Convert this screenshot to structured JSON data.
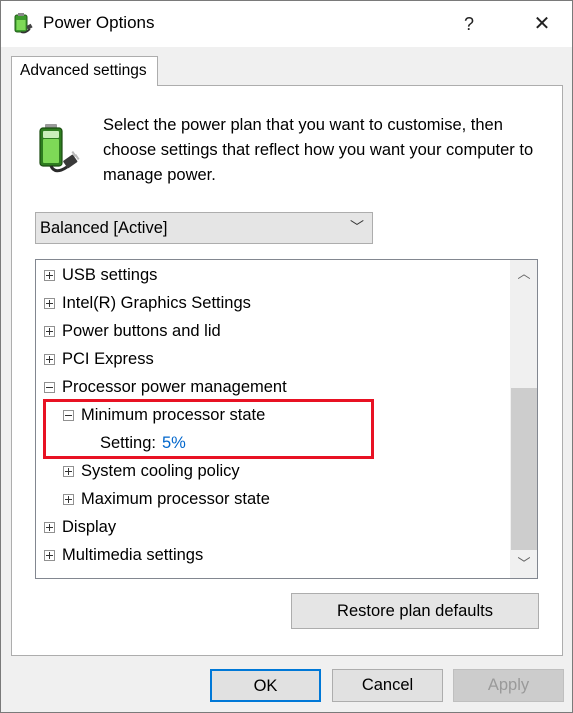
{
  "window": {
    "title": "Power Options",
    "help_label": "?",
    "close_label": "✕"
  },
  "tab": {
    "label": "Advanced settings"
  },
  "description": "Select the power plan that you want to customise, then choose settings that reflect how you want your computer to manage power.",
  "plan_select": {
    "value": "Balanced [Active]",
    "chevron": "﹀"
  },
  "tree": {
    "items": [
      {
        "label": "USB settings"
      },
      {
        "label": "Intel(R) Graphics Settings"
      },
      {
        "label": "Power buttons and lid"
      },
      {
        "label": "PCI Express"
      },
      {
        "label": "Processor power management"
      },
      {
        "label": "Minimum processor state"
      },
      {
        "label": "Setting:",
        "value": "5%"
      },
      {
        "label": "System cooling policy"
      },
      {
        "label": "Maximum processor state"
      },
      {
        "label": "Display"
      },
      {
        "label": "Multimedia settings"
      }
    ]
  },
  "scrollbar": {
    "up": "︿",
    "down": "﹀"
  },
  "buttons": {
    "restore": "Restore plan defaults",
    "ok": "OK",
    "cancel": "Cancel",
    "apply": "Apply"
  },
  "colors": {
    "highlight": "#e81123",
    "setting_value": "#0066cc",
    "focus": "#0078d7"
  }
}
